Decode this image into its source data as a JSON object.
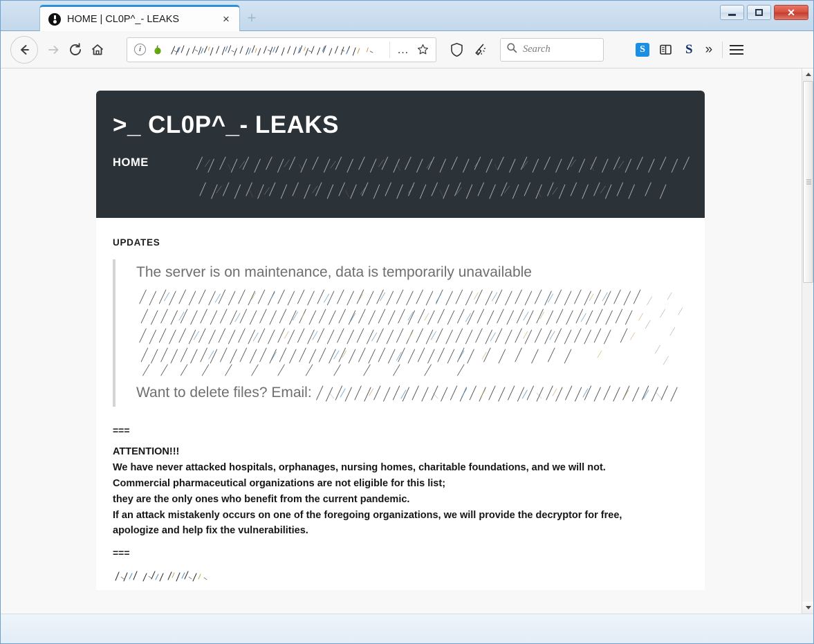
{
  "browser": {
    "tab": {
      "title": "HOME | CL0P^_- LEAKS",
      "favicon_name": "onion-favicon",
      "close_label": "×",
      "newtab_label": "+"
    },
    "window_controls": {
      "minimize_label": "–",
      "maximize_label": "❐",
      "close_label": "✕"
    },
    "toolbar": {
      "back_label": "←",
      "forward_label": "→",
      "reload_label": "⟳",
      "home_label": "⌂",
      "page_actions_label": "…",
      "bookmark_label": "☆",
      "shield_label": "shield",
      "cleanup_label": "new-identity",
      "extension_badge_label": "S",
      "sidebar_label": "sidebar",
      "extension_s_label": "S",
      "overflow_label": "»",
      "menu_label": "menu"
    },
    "urlbar": {
      "info_label": "i",
      "onion_label": "onion",
      "url_value": "[redacted]"
    },
    "search": {
      "placeholder": "Search",
      "value": ""
    }
  },
  "site": {
    "header": {
      "title": ">_ CL0P^_- LEAKS",
      "nav": {
        "home": "HOME",
        "other_items": "[redacted]"
      }
    },
    "updates": {
      "heading": "UPDATES",
      "notice": "The server is on maintenance, data is temporarily unavailable",
      "redacted_body": "[redacted]",
      "contact_prompt": "Want to delete files? Email:",
      "contact_redacted": "[redacted]"
    },
    "separator_top": "===",
    "attention": {
      "heading": "ATTENTION!!!",
      "lines": [
        "We have never attacked hospitals, orphanages, nursing homes, charitable foundations, and we will not.",
        "Commercial pharmaceutical organizations are not eligible for this list;",
        "they are the only ones who benefit from the current pandemic.",
        "If an attack mistakenly occurs on one of the foregoing organizations, we will provide the decryptor for free,",
        "apologize and help fix the vulnerabilities."
      ]
    },
    "separator_bottom": "===",
    "trailing_redacted": "[redacted]"
  },
  "colors": {
    "header_bg": "#2b3238",
    "page_bg": "#f8f8f8",
    "card_bg": "#ffffff",
    "accent_tab": "#2e8fd6",
    "close_button": "#d6503f",
    "quote_border": "#d4d4d4",
    "notice_text": "#6f6f6f",
    "onion_green": "#62a30f"
  }
}
